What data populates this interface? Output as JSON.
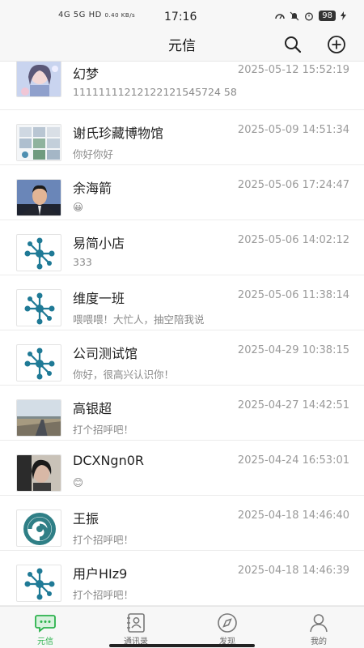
{
  "status": {
    "network": "4G 5G HD",
    "speed": "0.40 KB/s",
    "time": "17:16",
    "battery": "98"
  },
  "header": {
    "title": "元信"
  },
  "conversations": [
    {
      "name": "幻梦",
      "time": "2025-05-12 15:52:19",
      "message": "11111111212122121545724 58",
      "avatar": "anime-girl"
    },
    {
      "name": "谢氏珍藏博物馆",
      "time": "2025-05-09 14:51:34",
      "message": "你好你好",
      "avatar": "photo-grid"
    },
    {
      "name": "余海箭",
      "time": "2025-05-06 17:24:47",
      "message": "😀",
      "avatar": "portrait-man"
    },
    {
      "name": "易简小店",
      "time": "2025-05-06 14:02:12",
      "message": "333",
      "avatar": "molecule"
    },
    {
      "name": "维度一班",
      "time": "2025-05-06 11:38:14",
      "message": "喂喂喂！大忙人，抽空陪我说",
      "avatar": "molecule"
    },
    {
      "name": "公司测试馆",
      "time": "2025-04-29 10:38:15",
      "message": "你好，很高兴认识你！",
      "avatar": "molecule"
    },
    {
      "name": "高银超",
      "time": "2025-04-27 14:42:51",
      "message": "打个招呼吧！",
      "avatar": "landscape"
    },
    {
      "name": "DCXNgn0R",
      "time": "2025-04-24 16:53:01",
      "message": "😊",
      "avatar": "dark-portrait"
    },
    {
      "name": "王振",
      "time": "2025-04-18 14:46:40",
      "message": "打个招呼吧！",
      "avatar": "swirl-logo"
    },
    {
      "name": "用户HIz9",
      "time": "2025-04-18 14:46:39",
      "message": "打个招呼吧！",
      "avatar": "molecule"
    }
  ],
  "tabs": [
    {
      "label": "元信",
      "icon": "chat-icon",
      "active": true
    },
    {
      "label": "通讯录",
      "icon": "contacts-icon",
      "active": false
    },
    {
      "label": "发现",
      "icon": "compass-icon",
      "active": false
    },
    {
      "label": "我的",
      "icon": "profile-icon",
      "active": false
    }
  ],
  "colors": {
    "accent": "#2bb24c",
    "molecule": "#1f7a96"
  }
}
